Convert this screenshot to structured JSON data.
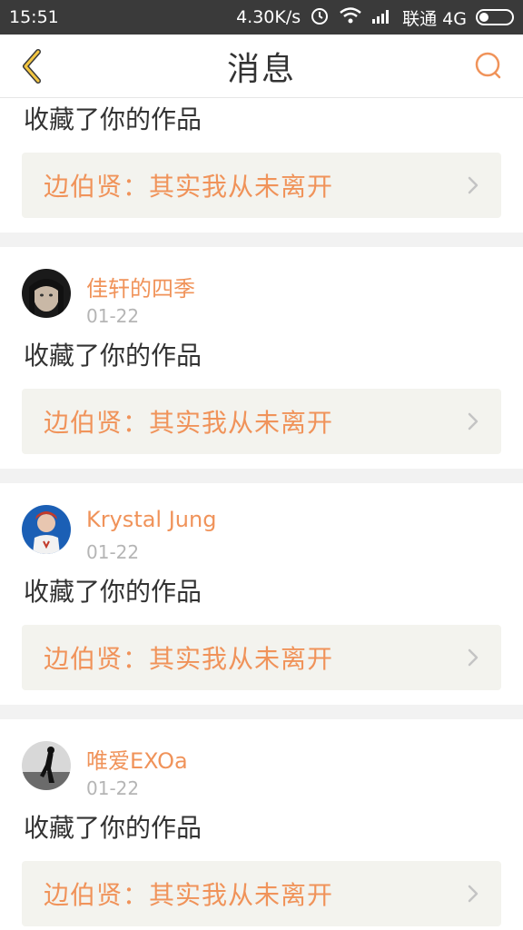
{
  "status_bar": {
    "time": "15:51",
    "speed": "4.30K/s",
    "carrier": "联通 4G",
    "icons": [
      "alarm-icon",
      "wifi-icon",
      "signal-icon",
      "battery-icon"
    ]
  },
  "nav": {
    "title": "消息",
    "back_icon": "chevron-left-icon",
    "search_icon": "search-icon",
    "accent_color": "#f3c642"
  },
  "colors": {
    "username": "#f0935a",
    "work_title": "#f0935a",
    "link_bg": "#f3f3ee",
    "divider": "#f2f2f2"
  },
  "messages": [
    {
      "username": "",
      "date": "",
      "action": "收藏了你的作品",
      "work_title": "边伯贤：其实我从未离开"
    },
    {
      "username": "佳轩的四季",
      "date": "01-22",
      "action": "收藏了你的作品",
      "work_title": "边伯贤：其实我从未离开"
    },
    {
      "username": "Krystal Jung",
      "date": "01-22",
      "action": "收藏了你的作品",
      "work_title": "边伯贤：其实我从未离开"
    },
    {
      "username": "唯爱EXOa",
      "date": "01-22",
      "action": "收藏了你的作品",
      "work_title": "边伯贤：其实我从未离开"
    }
  ]
}
